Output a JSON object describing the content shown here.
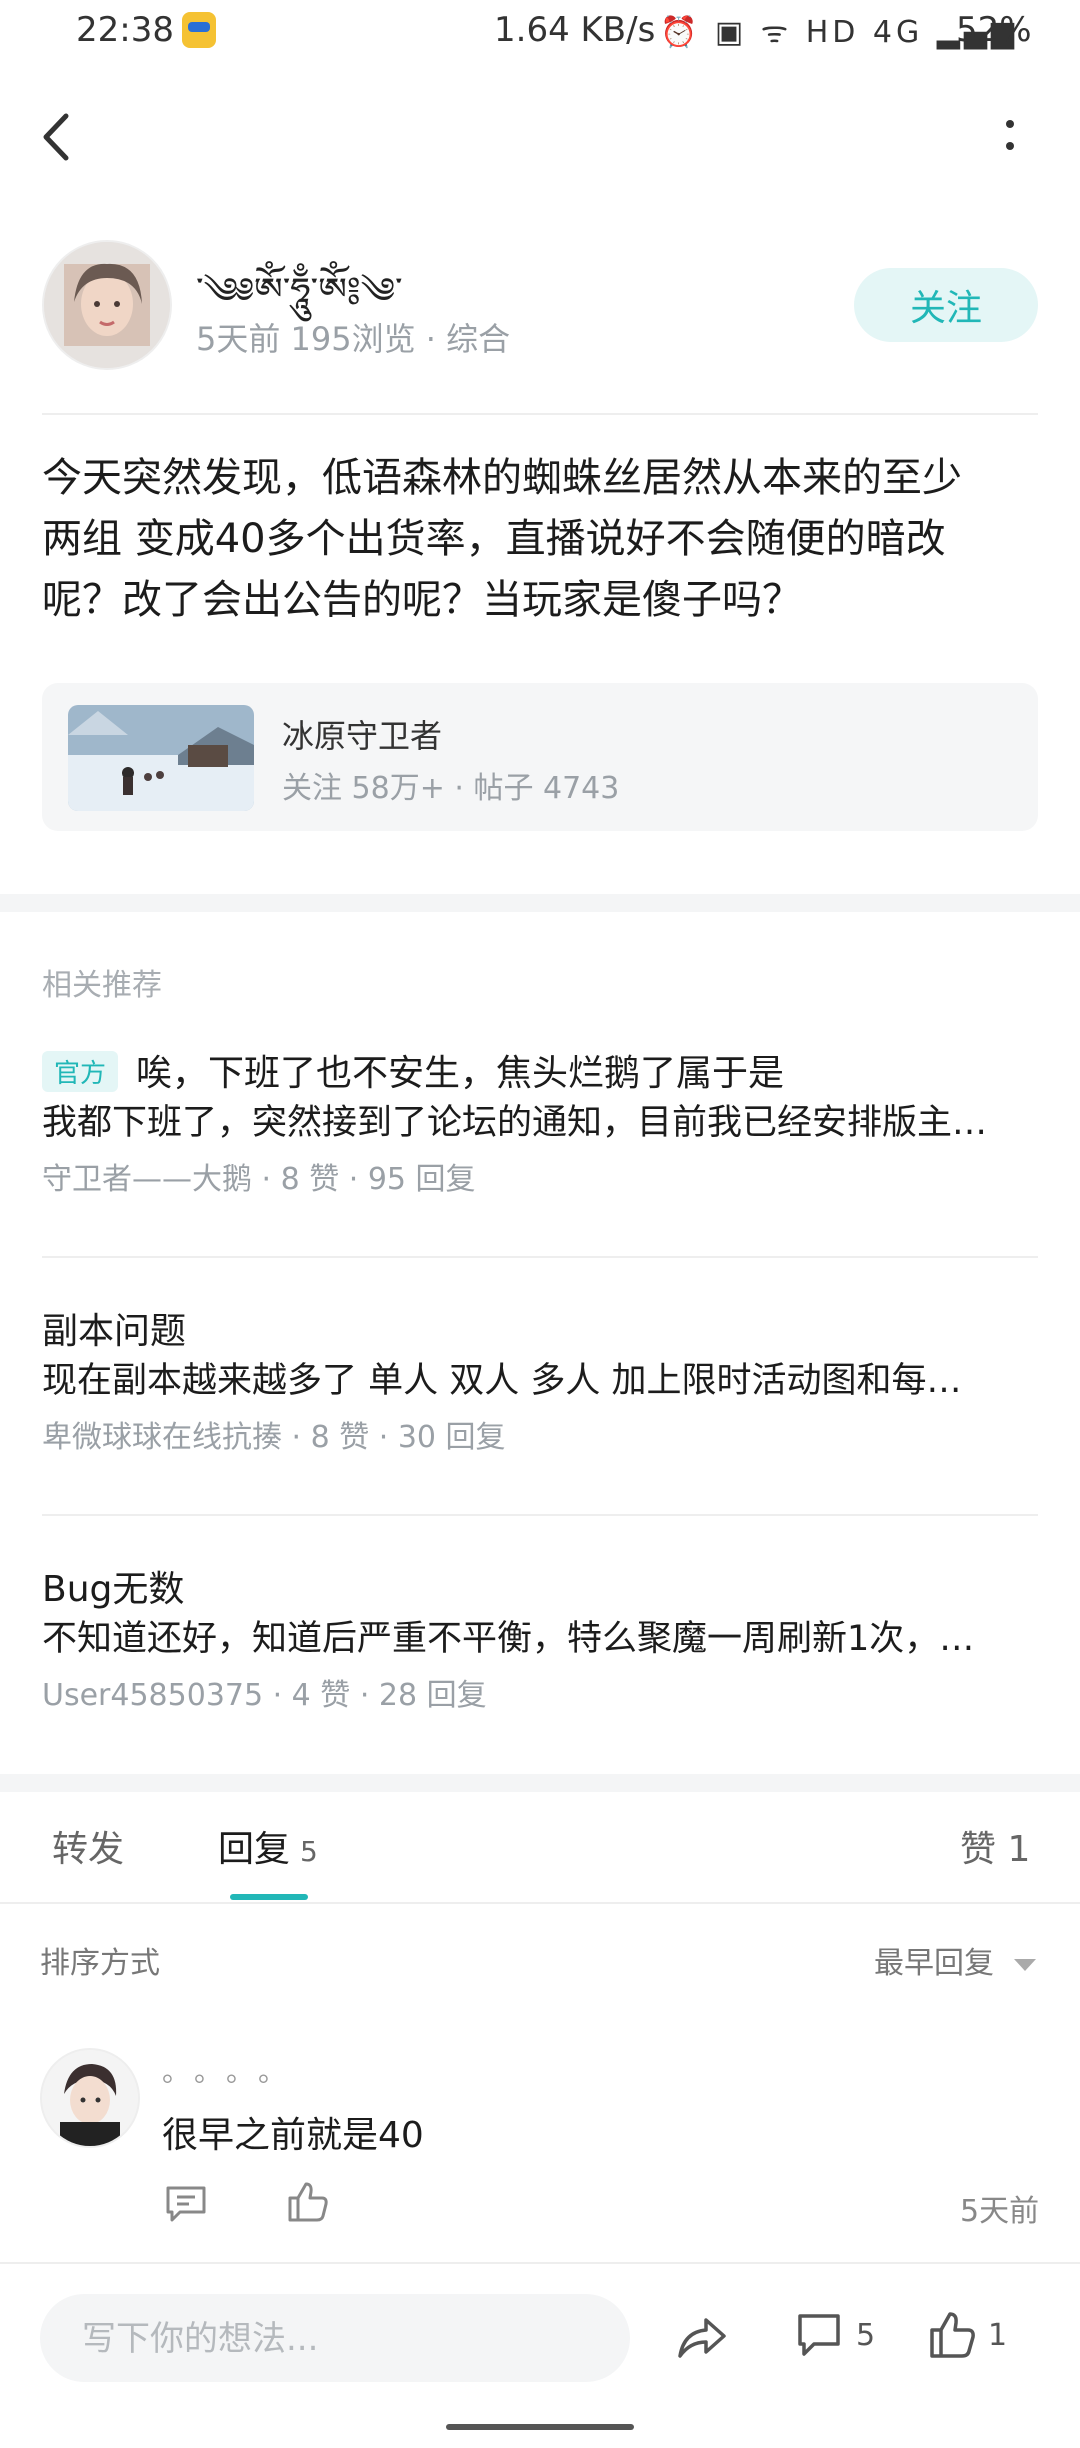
{
  "status_bar": {
    "time": "22:38",
    "net_speed": "1.64 KB/s",
    "indicators": "⏰ ▣ ᯤ HD 4G ▂▄▆",
    "battery": "52%"
  },
  "author": {
    "username": "་༄༅ཨོཾ་ཧཱུྃ་ཨོཾ༔༄་",
    "meta": "5天前 195浏览 · 综合",
    "follow_label": "关注"
  },
  "post": {
    "line1": "今天突然发现，低语森林的蜘蛛丝居然从本来的至少",
    "line2": "两组 变成40多个出货率，直播说好不会随便的暗改",
    "line3": "呢？改了会出公告的呢？当玩家是傻子吗？"
  },
  "game": {
    "name": "冰原守卫者",
    "stats": "关注 58万+ · 帖子 4743"
  },
  "related": {
    "section_title": "相关推荐",
    "items": [
      {
        "tag": "官方",
        "title": "唉，下班了也不安生，焦头烂鹅了属于是",
        "excerpt": "我都下班了，突然接到了论坛的通知，目前我已经安排版主…",
        "meta": "守卫者——大鹅 · 8 赞 · 95 回复"
      },
      {
        "title": "副本问题",
        "excerpt": "现在副本越来越多了  单人 双人  多人 加上限时活动图和每…",
        "meta": "卑微球球在线抗揍 · 8 赞 · 30 回复"
      },
      {
        "title": "Bug无数",
        "excerpt": "不知道还好，知道后严重不平衡，特么聚魔一周刷新1次，…",
        "meta": "User45850375 · 4 赞 · 28 回复"
      }
    ]
  },
  "tabs": {
    "forward": "转发",
    "reply": "回复",
    "reply_count": "5",
    "like": "赞 1"
  },
  "sort": {
    "label": "排序方式",
    "selected": "最早回复"
  },
  "comment": {
    "name": "。。。。",
    "text": "很早之前就是40",
    "time": "5天前"
  },
  "bottom_bar": {
    "placeholder": "写下你的想法...",
    "comment_count": "5",
    "like_count": "1"
  },
  "colors": {
    "accent": "#21b7b7",
    "accent_bg": "#e4f6f6"
  }
}
